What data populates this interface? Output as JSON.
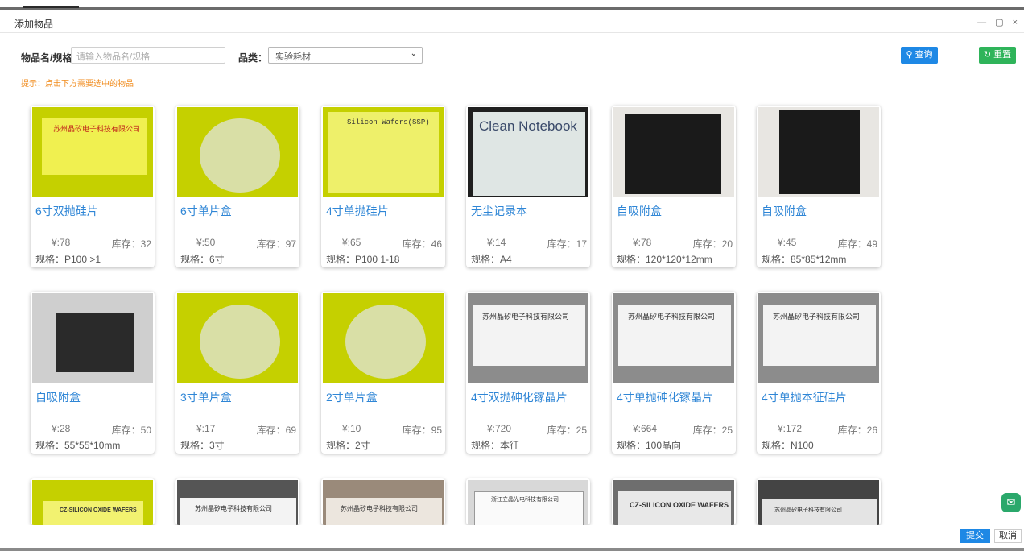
{
  "window": {
    "title": "添加物品",
    "controls": "— ▢ ×"
  },
  "search": {
    "name_label": "物品名/规格",
    "name_placeholder": "请输入物品名/规格",
    "category_label": "品类：",
    "category_selected": "实验耗材",
    "query_button": "查询",
    "reset_button": "重置"
  },
  "hint": "提示：点击下方需要选中的物品",
  "items": [
    {
      "name": "6寸双抛硅片",
      "price": "¥:78",
      "stock": "库存：32",
      "spec": "规格：P100 >1",
      "image_text": "苏州晶矽电子科技有限公司"
    },
    {
      "name": "6寸单片盒",
      "price": "¥:50",
      "stock": "库存：97",
      "spec": "规格：6寸"
    },
    {
      "name": "4寸单抛硅片",
      "price": "¥:65",
      "stock": "库存：46",
      "spec": "规格：P100 1-18",
      "image_text": "Silicon Wafers(SSP)"
    },
    {
      "name": "无尘记录本",
      "price": "¥:14",
      "stock": "库存：17",
      "spec": "规格：A4",
      "image_text": "Clean Notebook"
    },
    {
      "name": "自吸附盒",
      "price": "¥:78",
      "stock": "库存：20",
      "spec": "规格：120*120*12mm"
    },
    {
      "name": "自吸附盒",
      "price": "¥:45",
      "stock": "库存：49",
      "spec": "规格：85*85*12mm"
    },
    {
      "name": "自吸附盒",
      "price": "¥:28",
      "stock": "库存：50",
      "spec": "规格：55*55*10mm"
    },
    {
      "name": "3寸单片盒",
      "price": "¥:17",
      "stock": "库存：69",
      "spec": "规格：3寸"
    },
    {
      "name": "2寸单片盒",
      "price": "¥:10",
      "stock": "库存：95",
      "spec": "规格：2寸"
    },
    {
      "name": "4寸双抛砷化镓晶片",
      "price": "¥:720",
      "stock": "库存：25",
      "spec": "规格：本征",
      "image_text": "苏州晶矽电子科技有限公司"
    },
    {
      "name": "4寸单抛砷化镓晶片",
      "price": "¥:664",
      "stock": "库存：25",
      "spec": "规格：100晶向",
      "image_text": "苏州晶矽电子科技有限公司"
    },
    {
      "name": "4寸单抛本征硅片",
      "price": "¥:172",
      "stock": "库存：26",
      "spec": "规格：N100",
      "image_text": "苏州晶矽电子科技有限公司"
    }
  ],
  "partial_items": [
    {
      "image_text": "CZ-SILICON OXIDE WAFERS"
    },
    {
      "image_text": "苏州晶矽电子科技有限公司"
    },
    {
      "image_text": "苏州晶矽电子科技有限公司"
    },
    {
      "image_text": "浙江立晶光电科技有限公司"
    },
    {
      "image_text": "CZ-SILICON OXIDE WAFERS"
    },
    {
      "image_text": "苏州晶矽电子科技有限公司"
    }
  ],
  "footer": {
    "submit": "提交",
    "cancel": "取消"
  },
  "colors": {
    "primary": "#1e88e5",
    "success": "#2fb45a",
    "hint": "#f08a1a",
    "link": "#2f86d6"
  }
}
